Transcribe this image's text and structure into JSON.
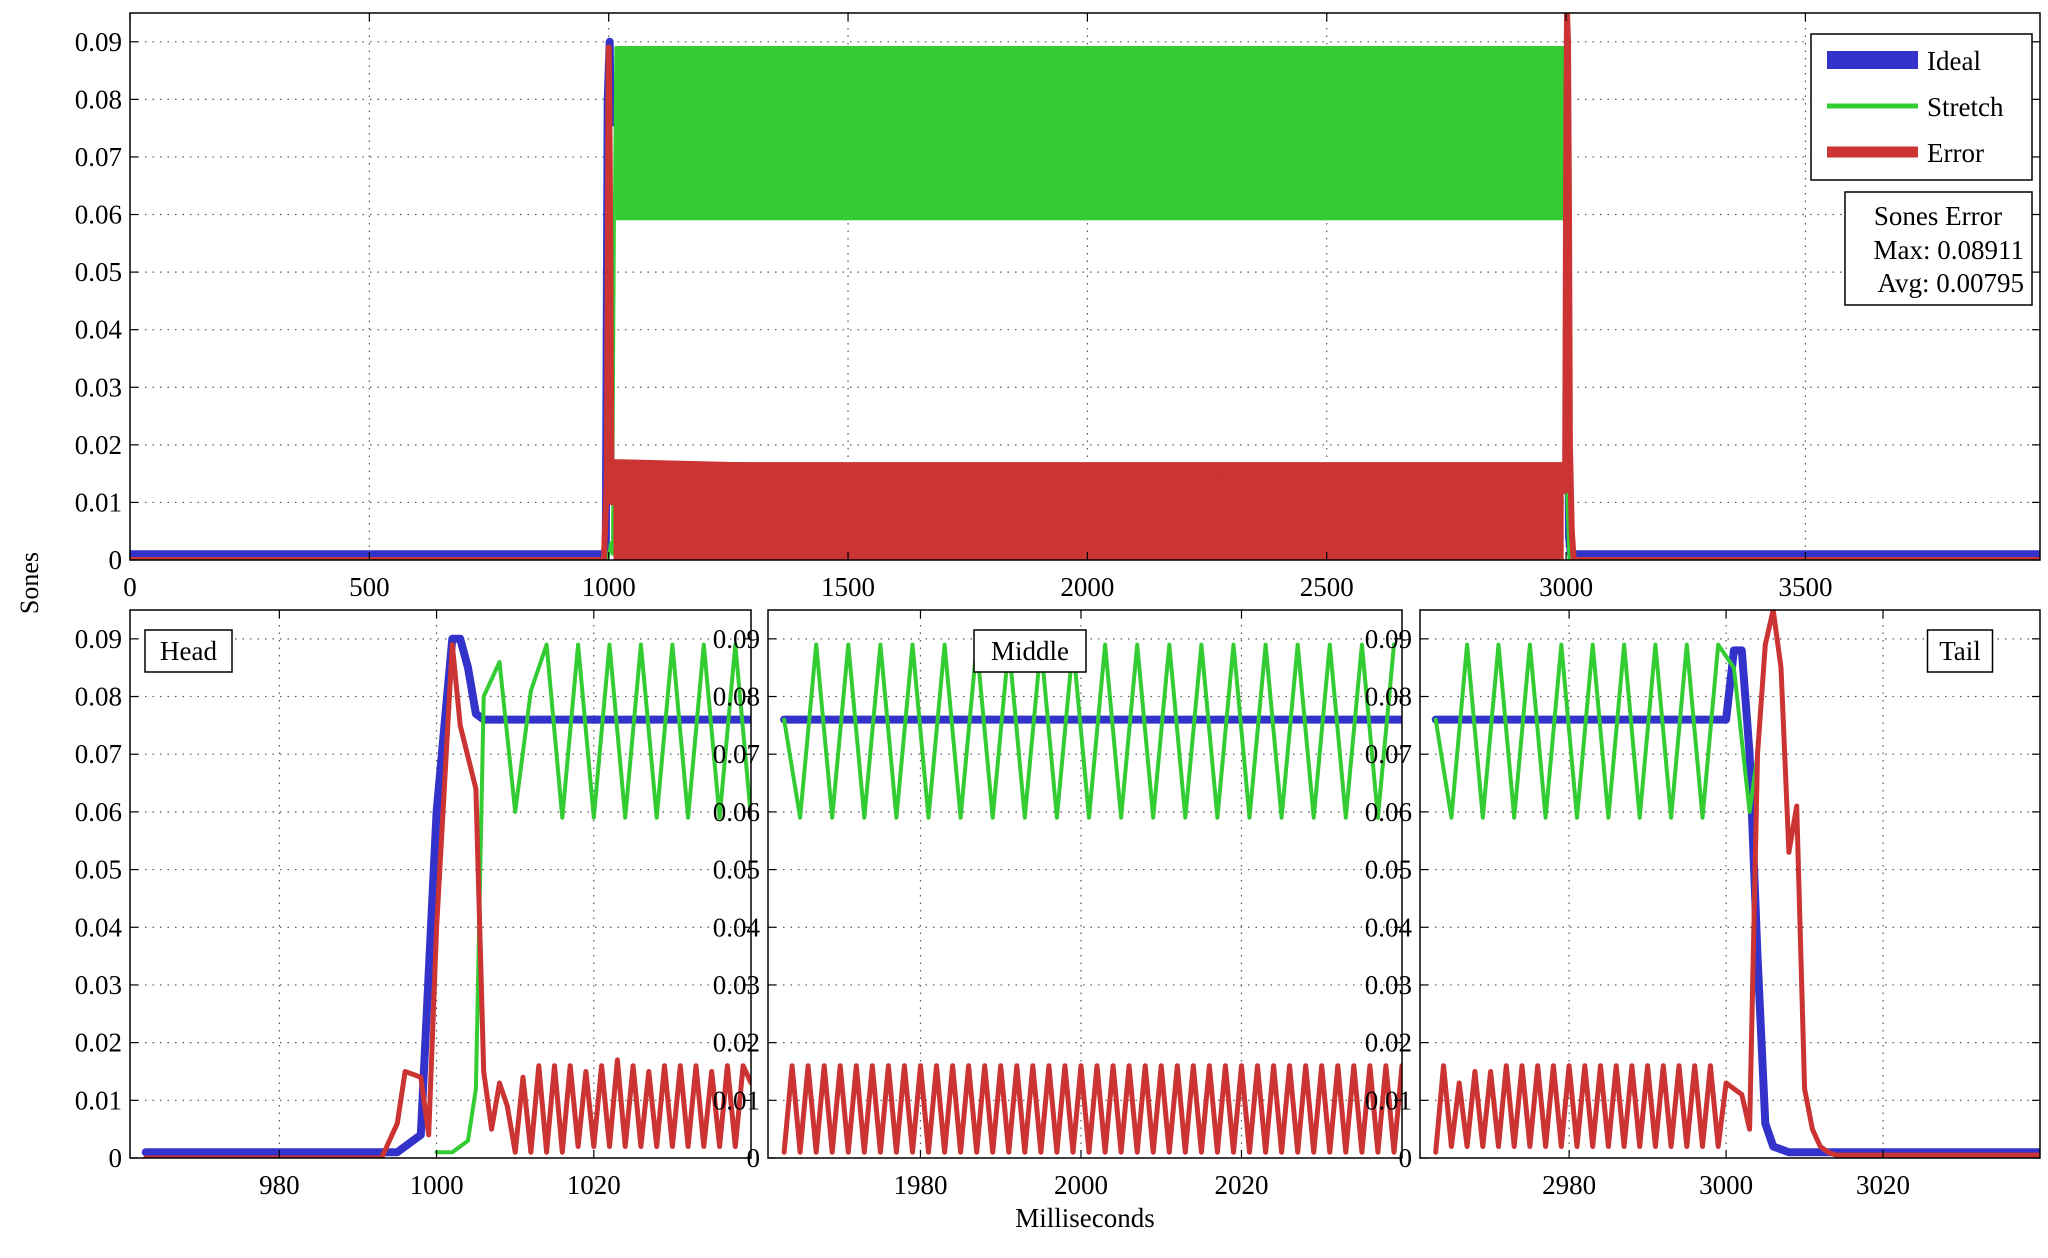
{
  "figure": {
    "ylabel": "Sones",
    "xlabel": "Milliseconds"
  },
  "colors": {
    "ideal": "#3333cc",
    "stretch": "#33cc33",
    "error": "#cc3333",
    "grid": "#555555"
  },
  "legend": {
    "position": "top-right",
    "entries": [
      "Ideal",
      "Stretch",
      "Error"
    ]
  },
  "stats_box": {
    "title": "Sones Error",
    "max": "Max: 0.08911",
    "avg": "Avg: 0.00795"
  },
  "chart_data": [
    {
      "type": "line",
      "panel": "full",
      "title": "",
      "xlabel": "",
      "ylabel": "Sones",
      "xlim": [
        0,
        3990
      ],
      "ylim": [
        0,
        0.095
      ],
      "xticks": [
        0,
        500,
        1000,
        1500,
        2000,
        2500,
        3000,
        3500
      ],
      "yticks": [
        0,
        0.01,
        0.02,
        0.03,
        0.04,
        0.05,
        0.06,
        0.07,
        0.08,
        0.09
      ],
      "grid": true,
      "series": [
        {
          "name": "Ideal",
          "key": "ideal",
          "width": 8,
          "x": [
            0,
            990,
            994,
            998,
            1002,
            1004,
            1006,
            2996,
            2998,
            3000,
            3002,
            3006,
            3010,
            3990
          ],
          "y": [
            0.001,
            0.001,
            0.002,
            0.08,
            0.09,
            0.078,
            0.076,
            0.076,
            0.08,
            0.088,
            0.07,
            0.004,
            0.001,
            0.001
          ]
        },
        {
          "name": "Stretch",
          "key": "stretch",
          "width": 3,
          "band": {
            "x0": 1015,
            "x1": 2995,
            "low": 0.059,
            "high": 0.089
          },
          "x": [
            0,
            998,
            1000,
            1004,
            1008,
            1012,
            1015,
            2995,
            2998,
            3002,
            3006,
            3990
          ],
          "y": [
            0,
            0,
            0.001,
            0.003,
            0.001,
            0.06,
            0.089,
            0.089,
            0.06,
            0.01,
            0,
            0
          ]
        },
        {
          "name": "Error",
          "key": "error",
          "width": 6,
          "band": {
            "x0": 1010,
            "x1": 2995,
            "low": 0.0,
            "high": 0.017
          },
          "x": [
            0,
            990,
            996,
            1000,
            1002,
            1006,
            1010,
            2995,
            2998,
            3000,
            3002,
            3004,
            3006,
            3008,
            3012,
            3016,
            3990
          ],
          "y": [
            0,
            0,
            0.014,
            0.089,
            0.07,
            0.01,
            0.017,
            0.013,
            0.012,
            0.065,
            0.095,
            0.09,
            0.06,
            0.02,
            0.005,
            0,
            0
          ]
        }
      ]
    },
    {
      "type": "line",
      "panel": "head",
      "title": "Head",
      "xlim": [
        961,
        1040
      ],
      "ylim": [
        0,
        0.095
      ],
      "xticks": [
        980,
        1000,
        1020
      ],
      "yticks": [
        0,
        0.01,
        0.02,
        0.03,
        0.04,
        0.05,
        0.06,
        0.07,
        0.08,
        0.09
      ],
      "grid": true,
      "series": [
        {
          "name": "Ideal",
          "key": "ideal",
          "width": 8,
          "x": [
            963,
            995,
            998,
            1000,
            1002,
            1003,
            1004,
            1005,
            1006,
            1040
          ],
          "y": [
            0.001,
            0.001,
            0.004,
            0.06,
            0.09,
            0.09,
            0.085,
            0.077,
            0.076,
            0.076
          ]
        },
        {
          "name": "Stretch",
          "key": "stretch",
          "width": 4,
          "x": [
            1000,
            1002,
            1004,
            1005,
            1006,
            1008,
            1010,
            1012,
            1014,
            1016,
            1018,
            1020,
            1022,
            1024,
            1026,
            1028,
            1030,
            1032,
            1034,
            1036,
            1038,
            1040
          ],
          "y": [
            0.001,
            0.001,
            0.003,
            0.012,
            0.08,
            0.086,
            0.06,
            0.081,
            0.089,
            0.059,
            0.089,
            0.059,
            0.089,
            0.059,
            0.089,
            0.059,
            0.089,
            0.059,
            0.089,
            0.059,
            0.089,
            0.059
          ]
        },
        {
          "name": "Error",
          "key": "error",
          "width": 5,
          "x": [
            963,
            993,
            995,
            996,
            998,
            999,
            1000,
            1002,
            1003,
            1005,
            1006,
            1007,
            1008,
            1009,
            1010,
            1011,
            1012,
            1013,
            1014,
            1015,
            1016,
            1017,
            1018,
            1019,
            1020,
            1021,
            1022,
            1023,
            1024,
            1025,
            1026,
            1027,
            1028,
            1029,
            1030,
            1031,
            1032,
            1033,
            1034,
            1035,
            1036,
            1037,
            1038,
            1039,
            1040
          ],
          "y": [
            0,
            0,
            0.006,
            0.015,
            0.014,
            0.004,
            0.04,
            0.089,
            0.075,
            0.064,
            0.015,
            0.005,
            0.013,
            0.009,
            0.001,
            0.014,
            0.001,
            0.016,
            0.001,
            0.016,
            0.001,
            0.016,
            0.002,
            0.015,
            0.002,
            0.016,
            0.002,
            0.017,
            0.002,
            0.016,
            0.002,
            0.015,
            0.002,
            0.016,
            0.002,
            0.016,
            0.002,
            0.016,
            0.002,
            0.015,
            0.002,
            0.016,
            0.002,
            0.016,
            0.013
          ]
        }
      ]
    },
    {
      "type": "line",
      "panel": "middle",
      "title": "Middle",
      "xlim": [
        1961,
        2040
      ],
      "ylim": [
        0,
        0.095
      ],
      "xticks": [
        1980,
        2000,
        2020
      ],
      "yticks": [
        0,
        0.01,
        0.02,
        0.03,
        0.04,
        0.05,
        0.06,
        0.07,
        0.08,
        0.09
      ],
      "grid": true,
      "series": [
        {
          "name": "Ideal",
          "key": "ideal",
          "width": 8,
          "x": [
            1963,
            2040
          ],
          "y": [
            0.076,
            0.076
          ]
        },
        {
          "name": "Stretch",
          "key": "stretch",
          "width": 4,
          "pattern": "zigzag",
          "x0": 1963,
          "x1": 2040,
          "step": 2.0,
          "start": 0.076,
          "low": 0.059,
          "high": 0.089
        },
        {
          "name": "Error",
          "key": "error",
          "width": 5,
          "pattern": "zigzag",
          "x0": 1963,
          "x1": 2040,
          "step": 1.0,
          "start": 0.001,
          "low": 0.001,
          "high": 0.016
        }
      ]
    },
    {
      "type": "line",
      "panel": "tail",
      "title": "Tail",
      "xlim": [
        2961,
        3040
      ],
      "ylim": [
        0,
        0.095
      ],
      "xticks": [
        2980,
        3000,
        3020
      ],
      "yticks": [
        0,
        0.01,
        0.02,
        0.03,
        0.04,
        0.05,
        0.06,
        0.07,
        0.08,
        0.09
      ],
      "grid": true,
      "series": [
        {
          "name": "Ideal",
          "key": "ideal",
          "width": 8,
          "x": [
            2963,
            3000,
            3001,
            3002,
            3003,
            3004,
            3005,
            3006,
            3008,
            3040
          ],
          "y": [
            0.076,
            0.076,
            0.088,
            0.088,
            0.07,
            0.035,
            0.006,
            0.002,
            0.001,
            0.001
          ]
        },
        {
          "name": "Stretch",
          "key": "stretch",
          "width": 4,
          "x": [
            2963,
            2965,
            2967,
            2969,
            2971,
            2973,
            2975,
            2977,
            2979,
            2981,
            2983,
            2985,
            2987,
            2989,
            2991,
            2993,
            2995,
            2997,
            2999,
            3001,
            3003,
            3004
          ],
          "y": [
            0.076,
            0.059,
            0.089,
            0.059,
            0.089,
            0.059,
            0.089,
            0.059,
            0.089,
            0.059,
            0.089,
            0.059,
            0.089,
            0.059,
            0.089,
            0.059,
            0.089,
            0.059,
            0.089,
            0.085,
            0.06,
            0.07
          ]
        },
        {
          "name": "Error",
          "key": "error",
          "width": 5,
          "x": [
            2963,
            2964,
            2965,
            2966,
            2967,
            2968,
            2969,
            2970,
            2971,
            2972,
            2973,
            2974,
            2975,
            2976,
            2977,
            2978,
            2979,
            2980,
            2981,
            2982,
            2983,
            2984,
            2985,
            2986,
            2987,
            2988,
            2989,
            2990,
            2991,
            2992,
            2993,
            2994,
            2995,
            2996,
            2997,
            2998,
            2999,
            3000,
            3001,
            3002,
            3003,
            3004,
            3005,
            3006,
            3007,
            3008,
            3009,
            3010,
            3011,
            3012,
            3013,
            3014,
            3015,
            3016,
            3040
          ],
          "y": [
            0.001,
            0.016,
            0.002,
            0.013,
            0.002,
            0.015,
            0.002,
            0.015,
            0.002,
            0.016,
            0.002,
            0.016,
            0.002,
            0.016,
            0.002,
            0.016,
            0.002,
            0.016,
            0.002,
            0.016,
            0.002,
            0.016,
            0.002,
            0.016,
            0.002,
            0.016,
            0.002,
            0.016,
            0.002,
            0.016,
            0.002,
            0.016,
            0.002,
            0.016,
            0.002,
            0.016,
            0.002,
            0.013,
            0.012,
            0.011,
            0.005,
            0.07,
            0.089,
            0.095,
            0.085,
            0.053,
            0.061,
            0.012,
            0.005,
            0.002,
            0.001,
            0.0005,
            0.0005,
            0.0005,
            0.0005
          ]
        }
      ]
    }
  ]
}
